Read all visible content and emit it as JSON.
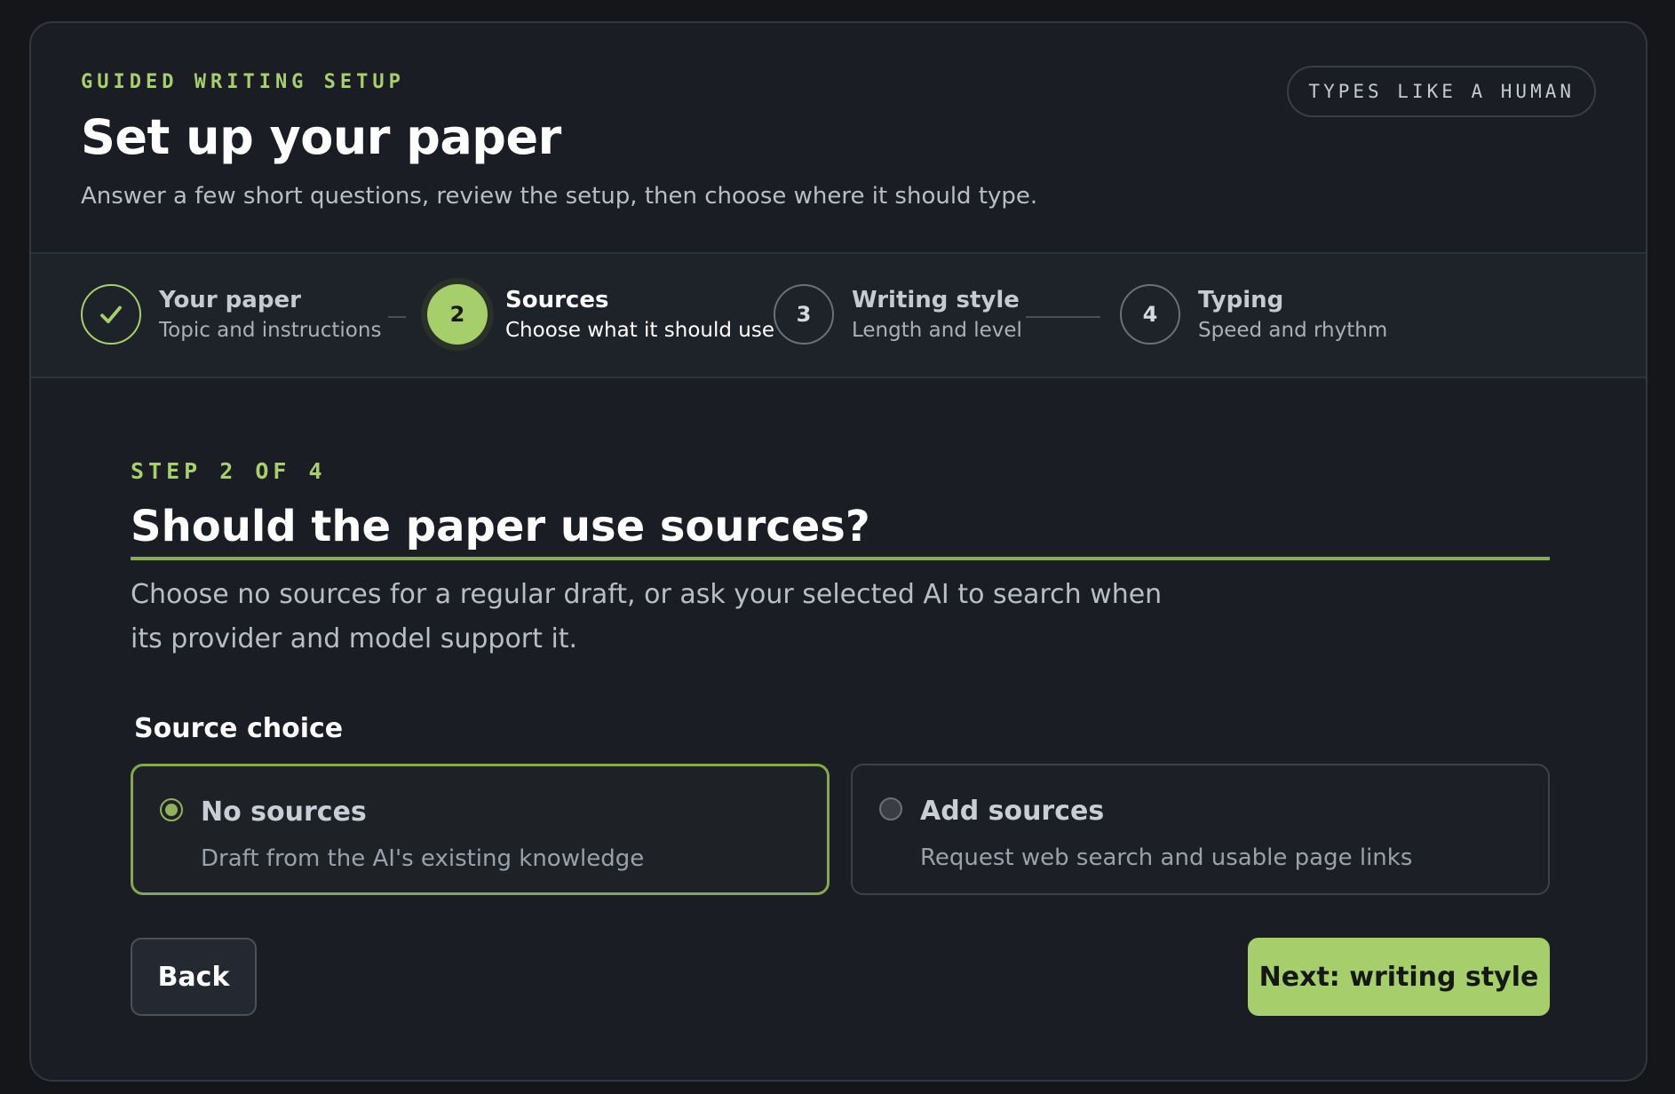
{
  "header": {
    "eyebrow": "GUIDED WRITING SETUP",
    "title": "Set up your paper",
    "subtitle": "Answer a few short questions, review the setup, then choose where it should type.",
    "badge": "TYPES LIKE A HUMAN"
  },
  "stepper": {
    "steps": [
      {
        "number": "",
        "title": "Your paper",
        "desc": "Topic and instructions",
        "state": "done",
        "icon": "check-icon"
      },
      {
        "number": "2",
        "title": "Sources",
        "desc": "Choose what it should use",
        "state": "active"
      },
      {
        "number": "3",
        "title": "Writing style",
        "desc": "Length and level",
        "state": "todo"
      },
      {
        "number": "4",
        "title": "Typing",
        "desc": "Speed and rhythm",
        "state": "todo"
      }
    ]
  },
  "main": {
    "step_count": "STEP 2 OF 4",
    "question": "Should the paper use sources?",
    "description": "Choose no sources for a regular draft, or ask your selected AI to search when its provider and model support it.",
    "field_label": "Source choice",
    "options": [
      {
        "title": "No sources",
        "desc": "Draft from the AI's existing knowledge",
        "selected": true
      },
      {
        "title": "Add sources",
        "desc": "Request web search and usable page links",
        "selected": false
      }
    ],
    "back_label": "Back",
    "next_label": "Next: writing style"
  },
  "colors": {
    "accent": "#a6cf6b",
    "background": "#1a1d23",
    "page": "#141619"
  }
}
